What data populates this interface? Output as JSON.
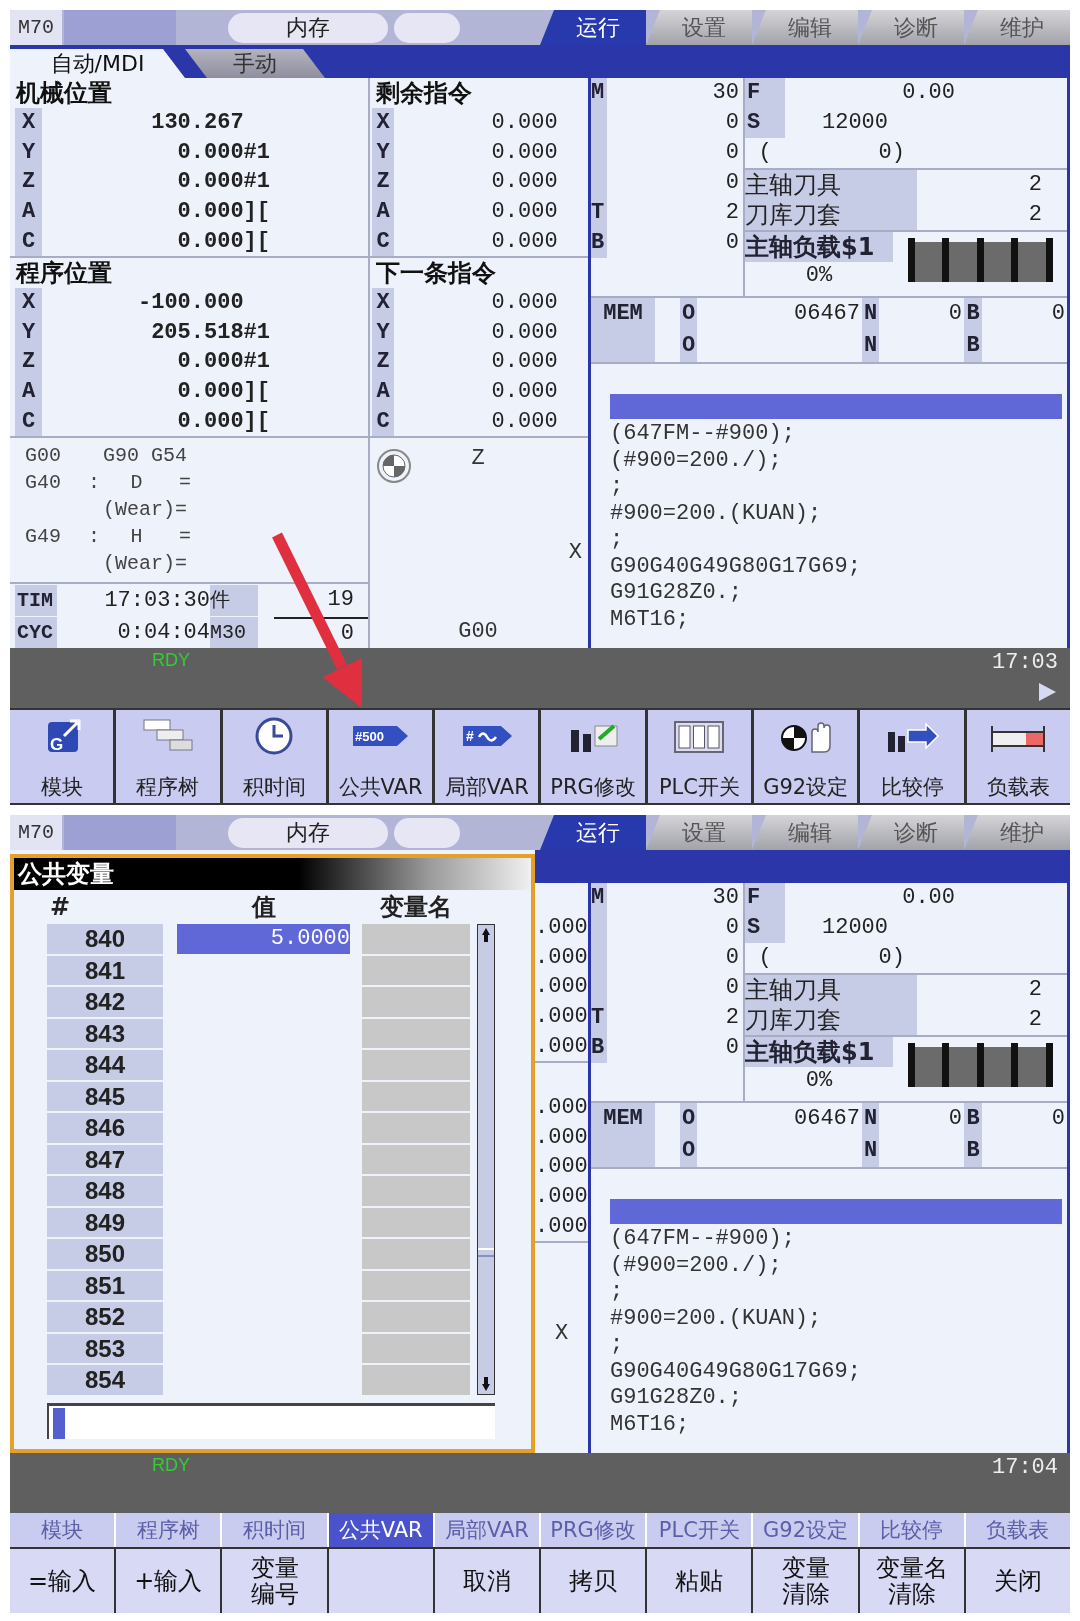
{
  "screens": [
    {
      "header": {
        "model": "M70",
        "mode": "内存"
      },
      "tabs": [
        {
          "label": "运行",
          "selected": true
        },
        {
          "label": "设置",
          "selected": false
        },
        {
          "label": "编辑",
          "selected": false
        },
        {
          "label": "诊断",
          "selected": false
        },
        {
          "label": "维护",
          "selected": false
        }
      ],
      "sub_tabs": [
        {
          "label": "自动/MDI",
          "selected": true
        },
        {
          "label": "手动",
          "selected": false
        }
      ],
      "machine_position": {
        "title": "机械位置",
        "axes": [
          {
            "axis": "X",
            "value": "130.267"
          },
          {
            "axis": "Y",
            "value": "0.000",
            "suffix": "#1"
          },
          {
            "axis": "Z",
            "value": "0.000",
            "suffix": "#1"
          },
          {
            "axis": "A",
            "value": "0.000",
            "suffix": "]["
          },
          {
            "axis": "C",
            "value": "0.000",
            "suffix": "]["
          }
        ]
      },
      "program_position": {
        "title": "程序位置",
        "axes": [
          {
            "axis": "X",
            "value": "-100.000"
          },
          {
            "axis": "Y",
            "value": "205.518",
            "suffix": "#1"
          },
          {
            "axis": "Z",
            "value": "0.000",
            "suffix": "#1"
          },
          {
            "axis": "A",
            "value": "0.000",
            "suffix": "]["
          },
          {
            "axis": "C",
            "value": "0.000",
            "suffix": "]["
          }
        ]
      },
      "remaining_command": {
        "title": "剩余指令",
        "axes": [
          {
            "axis": "X",
            "value": "0.000"
          },
          {
            "axis": "Y",
            "value": "0.000"
          },
          {
            "axis": "Z",
            "value": "0.000"
          },
          {
            "axis": "A",
            "value": "0.000"
          },
          {
            "axis": "C",
            "value": "0.000"
          }
        ]
      },
      "next_command": {
        "title": "下一条指令",
        "axes": [
          {
            "axis": "X",
            "value": "0.000"
          },
          {
            "axis": "Y",
            "value": "0.000"
          },
          {
            "axis": "Z",
            "value": "0.000"
          },
          {
            "axis": "A",
            "value": "0.000"
          },
          {
            "axis": "C",
            "value": "0.000"
          }
        ]
      },
      "modal": [
        {
          "code": "G00",
          "value": "G90 G54"
        },
        {
          "code": "G40",
          "sep": ":",
          "name": "D",
          "eq": "="
        },
        {
          "value": "(Wear)="
        },
        {
          "code": "G49",
          "sep": ":",
          "name": "H",
          "eq": "="
        },
        {
          "value": "(Wear)="
        }
      ],
      "counters": [
        {
          "label": "TIM",
          "value": "17:03:30",
          "unit": "件",
          "count": "19"
        },
        {
          "label": "CYC",
          "value": "0:04:04",
          "unit": "M30",
          "count": "0"
        }
      ],
      "path_view": {
        "axis_v": "Z",
        "axis_h": "X",
        "mode": "G00"
      },
      "mst": [
        {
          "label": "M",
          "value": "30"
        },
        {
          "value": "0"
        },
        {
          "value": "0"
        },
        {
          "value": "0"
        },
        {
          "label": "T",
          "value": "2"
        },
        {
          "label": "B",
          "value": "0"
        }
      ],
      "feed": {
        "label": "F",
        "value": "0.00"
      },
      "spindle": {
        "label": "S",
        "value": "12000",
        "open": "(",
        "actual": "0)"
      },
      "tools": [
        {
          "label": "主轴刀具",
          "value": "2"
        },
        {
          "label": "刀库刀套",
          "value": "2"
        }
      ],
      "spindle_load": {
        "label": "主轴负载$1",
        "reading": "0%",
        "level": 0
      },
      "program_rows": [
        {
          "label": "MEM",
          "o": "O",
          "program": "06467",
          "n": "N",
          "n_value": "0",
          "b": "B",
          "b_value": "0"
        },
        {
          "o": "O",
          "n": "N",
          "b": "B"
        }
      ],
      "listing": [
        "(647FM--#900);",
        "(#900=200./);",
        ";",
        "#900=200.(KUAN);",
        ";",
        "G90G40G49G80G17G69;",
        "G91G28Z0.;",
        "M6T16;"
      ],
      "status": {
        "state": "RDY",
        "time": "17:03",
        "more_pages": true
      },
      "softkeys": [
        {
          "label": "模块",
          "badge": "G"
        },
        {
          "label": "程序树"
        },
        {
          "label": "积时间"
        },
        {
          "label": "公共VAR",
          "badge": "#500"
        },
        {
          "label": "局部VAR",
          "badge": "#"
        },
        {
          "label": "PRG修改"
        },
        {
          "label": "PLC开关"
        },
        {
          "label": "G92设定"
        },
        {
          "label": "比较停"
        },
        {
          "label": "负载表"
        }
      ]
    },
    {
      "header": {
        "model": "M70",
        "mode": "内存"
      },
      "tabs": [
        {
          "label": "运行",
          "selected": true
        },
        {
          "label": "设置",
          "selected": false
        },
        {
          "label": "编辑",
          "selected": false
        },
        {
          "label": "诊断",
          "selected": false
        },
        {
          "label": "维护",
          "selected": false
        }
      ],
      "dialog": {
        "title": "公共变量",
        "columns": [
          "#",
          "值",
          "变量名"
        ],
        "rows": [
          {
            "number": "840",
            "value": "5.0000",
            "selected": true
          },
          {
            "number": "841",
            "selected": false
          },
          {
            "number": "842",
            "selected": false
          },
          {
            "number": "843",
            "selected": false
          },
          {
            "number": "844",
            "selected": false
          },
          {
            "number": "845",
            "selected": false
          },
          {
            "number": "846",
            "selected": false
          },
          {
            "number": "847",
            "selected": false
          },
          {
            "number": "848",
            "selected": false
          },
          {
            "number": "849",
            "selected": false
          },
          {
            "number": "850",
            "selected": false
          },
          {
            "number": "851",
            "selected": false
          },
          {
            "number": "852",
            "selected": false
          },
          {
            "number": "853",
            "selected": false
          },
          {
            "number": "854",
            "selected": false
          }
        ]
      },
      "covered_values": [
        ".000",
        ".000",
        ".000",
        ".000",
        ".000",
        ".000",
        ".000",
        ".000",
        ".000",
        ".000"
      ],
      "covered_axis": "X",
      "mst": [
        {
          "label": "M",
          "value": "30"
        },
        {
          "value": "0"
        },
        {
          "value": "0"
        },
        {
          "value": "0"
        },
        {
          "label": "T",
          "value": "2"
        },
        {
          "label": "B",
          "value": "0"
        }
      ],
      "feed": {
        "label": "F",
        "value": "0.00"
      },
      "spindle": {
        "label": "S",
        "value": "12000",
        "open": "(",
        "actual": "0)"
      },
      "tools": [
        {
          "label": "主轴刀具",
          "value": "2"
        },
        {
          "label": "刀库刀套",
          "value": "2"
        }
      ],
      "spindle_load": {
        "label": "主轴负载$1",
        "reading": "0%",
        "level": 0
      },
      "program_rows": [
        {
          "label": "MEM",
          "o": "O",
          "program": "06467",
          "n": "N",
          "n_value": "0",
          "b": "B",
          "b_value": "0"
        },
        {
          "o": "O",
          "n": "N",
          "b": "B"
        }
      ],
      "listing": [
        "(647FM--#900);",
        "(#900=200./);",
        ";",
        "#900=200.(KUAN);",
        ";",
        "G90G40G49G80G17G69;",
        "G91G28Z0.;",
        "M6T16;"
      ],
      "status": {
        "state": "RDY",
        "time": "17:04",
        "more_pages": false
      },
      "menu": [
        {
          "label": "模块",
          "selected": false
        },
        {
          "label": "程序树",
          "selected": false
        },
        {
          "label": "积时间",
          "selected": false
        },
        {
          "label": "公共VAR",
          "selected": true
        },
        {
          "label": "局部VAR",
          "selected": false
        },
        {
          "label": "PRG修改",
          "selected": false
        },
        {
          "label": "PLC开关",
          "selected": false
        },
        {
          "label": "G92设定",
          "selected": false
        },
        {
          "label": "比较停",
          "selected": false
        },
        {
          "label": "负载表",
          "selected": false
        }
      ],
      "function_keys": [
        {
          "kind": "key",
          "lines": [
            "=输入"
          ]
        },
        {
          "kind": "key",
          "lines": [
            "+输入"
          ]
        },
        {
          "kind": "key",
          "lines": [
            "变量",
            "编号"
          ]
        },
        {
          "kind": "blank"
        },
        {
          "kind": "key",
          "lines": [
            "取消"
          ]
        },
        {
          "kind": "key",
          "lines": [
            "拷贝"
          ]
        },
        {
          "kind": "key",
          "lines": [
            "粘贴"
          ]
        },
        {
          "kind": "key",
          "lines": [
            "变量",
            "清除"
          ]
        },
        {
          "kind": "key",
          "lines": [
            "变量名",
            "清除"
          ]
        },
        {
          "kind": "key",
          "lines": [
            "关闭"
          ]
        }
      ]
    }
  ]
}
